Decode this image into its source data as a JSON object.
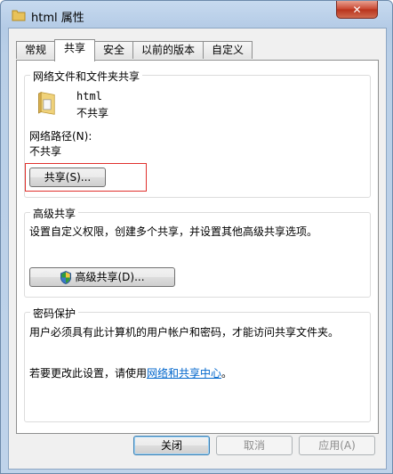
{
  "window": {
    "title": "html 属性",
    "close_icon": "✕"
  },
  "tabs": [
    {
      "label": "常规",
      "active": false
    },
    {
      "label": "共享",
      "active": true
    },
    {
      "label": "安全",
      "active": false
    },
    {
      "label": "以前的版本",
      "active": false
    },
    {
      "label": "自定义",
      "active": false
    }
  ],
  "network_share": {
    "group_title": "网络文件和文件夹共享",
    "folder_name": "html",
    "folder_status": "不共享",
    "path_label": "网络路径(N):",
    "path_value": "不共享",
    "share_button": "共享(S)..."
  },
  "advanced_share": {
    "group_title": "高级共享",
    "description": "设置自定义权限，创建多个共享，并设置其他高级共享选项。",
    "button": "高级共享(D)..."
  },
  "password": {
    "group_title": "密码保护",
    "description": "用户必须具有此计算机的用户帐户和密码，才能访问共享文件夹。",
    "change_text": "若要更改此设置，请使用",
    "link_text": "网络和共享中心",
    "suffix": "。"
  },
  "footer": {
    "ok": "关闭",
    "cancel": "取消",
    "apply": "应用(A)"
  },
  "colors": {
    "highlight_box": "#e0312d",
    "link": "#0066cc"
  }
}
